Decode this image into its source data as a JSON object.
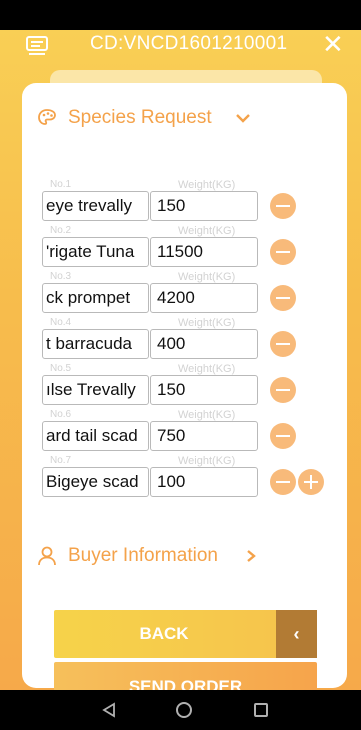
{
  "header": {
    "title": "CD:VNCD1601210001",
    "close_label": "✕",
    "menu_icon": "menu-icon"
  },
  "species_section": {
    "label": "Species Request",
    "icon": "palette-icon",
    "chevron": "chevron-down-icon"
  },
  "rows": [
    {
      "no": "No.1",
      "weight_label": "Weight(KG)",
      "name": "eye trevally",
      "weight": "150",
      "actions": [
        "remove"
      ]
    },
    {
      "no": "No.2",
      "weight_label": "Weight(KG)",
      "name": "'rigate Tuna",
      "weight": "11500",
      "actions": [
        "remove"
      ]
    },
    {
      "no": "No.3",
      "weight_label": "Weight(KG)",
      "name": "ck prompet",
      "weight": "4200",
      "actions": [
        "remove"
      ]
    },
    {
      "no": "No.4",
      "weight_label": "Weight(KG)",
      "name": "t barracuda",
      "weight": "400",
      "actions": [
        "remove"
      ]
    },
    {
      "no": "No.5",
      "weight_label": "Weight(KG)",
      "name": "ılse Trevally",
      "weight": "150",
      "actions": [
        "remove"
      ]
    },
    {
      "no": "No.6",
      "weight_label": "Weight(KG)",
      "name": "ard tail scad",
      "weight": "750",
      "actions": [
        "remove"
      ]
    },
    {
      "no": "No.7",
      "weight_label": "Weight(KG)",
      "name": "Bigeye scad",
      "weight": "100",
      "actions": [
        "remove",
        "add"
      ]
    }
  ],
  "buyer_section": {
    "label": "Buyer Information",
    "icon": "user-icon",
    "chevron": "chevron-right-icon"
  },
  "buttons": {
    "back_label": "BACK",
    "back_arrow": "‹",
    "send_label": "SEND ORDER"
  },
  "colors": {
    "accent": "#f4a24a",
    "header_gradient_top": "#f9cf55",
    "minus_circle": "#f8ba7a",
    "back_arrow_bg": "#b27b34"
  }
}
